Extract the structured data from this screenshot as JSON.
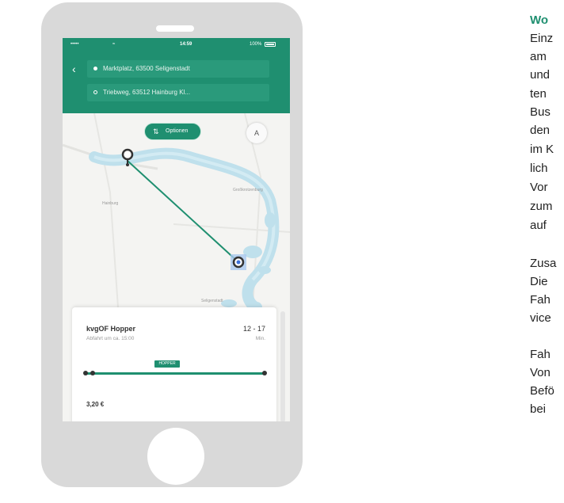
{
  "status_bar": {
    "signal": "•••••",
    "wifi": "≈",
    "time": "14:59",
    "battery": "100%"
  },
  "route": {
    "from": "Marktplatz, 63500 Seligenstadt",
    "to": "Triebweg, 63512 Hainburg Kl..."
  },
  "map": {
    "options_label": "Optionen",
    "compass_label": "A",
    "place_labels": [
      "Hainburg",
      "Großkrotzenburg",
      "Seligenstadt"
    ]
  },
  "trip": {
    "service": "kvgOF Hopper",
    "departure": "Abfahrt um ca. 15:00",
    "duration": "12 - 17",
    "duration_unit": "Min.",
    "badge": "HOPPER",
    "price": "3,20 €"
  },
  "side_text": {
    "title": "Wo",
    "lines": [
      "Einz",
      "am",
      "und",
      "ten",
      "Bus",
      "den",
      "im K",
      "lich",
      "Vor",
      "zum",
      "auf",
      "",
      "Zusa",
      "Die",
      "Fah",
      "vice",
      "",
      "Fah",
      "Von",
      "Befö",
      "bei"
    ]
  },
  "colors": {
    "brand": "#1f8f70",
    "water": "#bfe0ec",
    "phone": "#d9d9d9"
  }
}
